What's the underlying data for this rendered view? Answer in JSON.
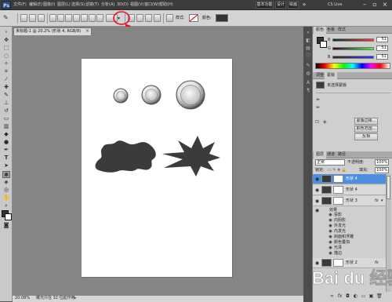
{
  "app": {
    "logo_text": "Ps",
    "menu": [
      "文件(F)",
      "编辑(E)",
      "图像(I)",
      "图层(L)",
      "选择(S)",
      "滤镜(T)",
      "分析(A)",
      "3D(D)",
      "视图(V)",
      "窗口(W)",
      "帮助(H)"
    ],
    "workspace_buttons": [
      "基本功能",
      "设计",
      "绘画"
    ],
    "cs_live": "CS Live"
  },
  "options": {
    "style_label": "样式:",
    "color_label": "颜色:"
  },
  "document": {
    "tab_title": "未标题-1 @ 20.2% (形状 4, RGB/8)",
    "zoom": "20.08%",
    "status": "曝光只在 32 位起作用"
  },
  "color_panel": {
    "tabs": [
      "颜色",
      "色板",
      "样式"
    ],
    "channels": [
      {
        "name": "R",
        "value": "51"
      },
      {
        "name": "G",
        "value": "51"
      },
      {
        "name": "B",
        "value": "51"
      }
    ]
  },
  "adjust_panel": {
    "tabs": [
      "调整",
      "蒙版"
    ],
    "title": "未选择蒙版",
    "buttons": [
      "蒙版边缘...",
      "颜色范围...",
      "反相"
    ]
  },
  "layers_panel": {
    "tabs": [
      "图层",
      "通道",
      "路径"
    ],
    "blend_mode": "正常",
    "opacity_label": "不透明度:",
    "opacity_value": "100%",
    "lock_label": "锁定:",
    "fill_label": "填充:",
    "fill_value": "100%",
    "layers": [
      {
        "name": "形状 4",
        "selected": true,
        "mask": true,
        "fx": false
      },
      {
        "name": "形状 4",
        "selected": false,
        "mask": true,
        "fx": false
      },
      {
        "name": "形状 3",
        "selected": false,
        "mask": true,
        "fx": true
      }
    ],
    "effects_label": "效果",
    "effects": [
      "投影",
      "内阴影",
      "外发光",
      "内发光",
      "斜面和浮雕",
      "颜色叠加",
      "光泽",
      "描边"
    ],
    "bottom_layer": {
      "name": "形状 2",
      "fx": true
    }
  },
  "watermark": "Bai du 经验",
  "colors": {
    "accent": "#4d8ee1",
    "arrow_red": "#e3122b",
    "shape_fill": "#3b3b3b"
  }
}
